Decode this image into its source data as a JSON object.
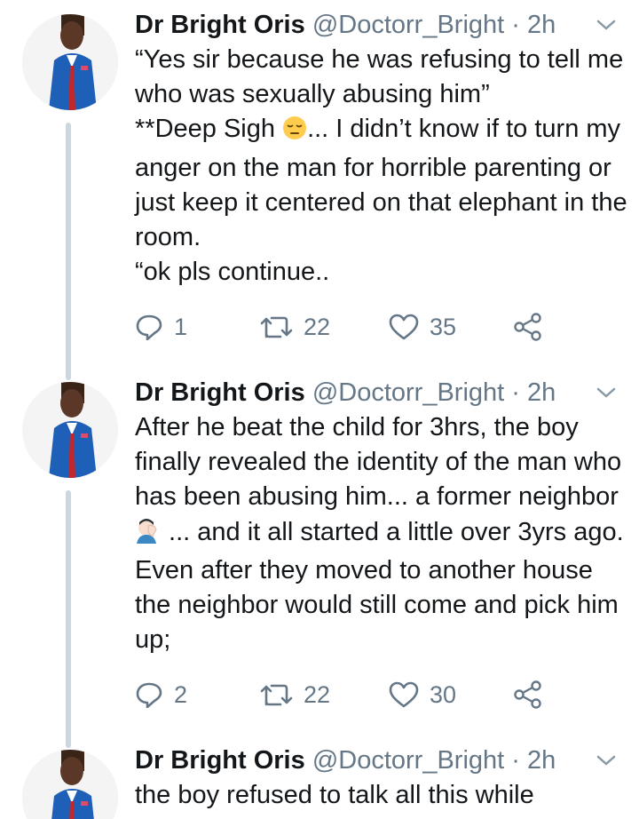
{
  "tweets": [
    {
      "name": "Dr Bright Oris",
      "handle": "@Doctorr_Bright",
      "time": "2h",
      "text_1": "“Yes sir because he was refusing to tell me who was sexually abusing him”\n**Deep Sigh ",
      "text_2": "... I didn’t know if to turn my anger on the man for horrible parenting or just keep it centered on that elephant in the room.\n“ok pls continue..",
      "emoji": "relieved-face-icon",
      "replies": "1",
      "retweets": "22",
      "likes": "35"
    },
    {
      "name": "Dr Bright Oris",
      "handle": "@Doctorr_Bright",
      "time": "2h",
      "text_1": "After he beat the child for 3hrs, the boy finally revealed the identity of the man who has been abusing him... a former neighbor ",
      "text_2": " ... and it all started a little over 3yrs ago. Even after they moved to another house the neighbor would still come and pick him up;",
      "emoji": "facepalm-icon",
      "replies": "2",
      "retweets": "22",
      "likes": "30"
    },
    {
      "name": "Dr Bright Oris",
      "handle": "@Doctorr_Bright",
      "time": "2h",
      "text_1": "the boy refused to talk all this while"
    }
  ],
  "colors": {
    "text": "#14171a",
    "secondary": "#657786",
    "thread_line": "#ccd6dd"
  }
}
